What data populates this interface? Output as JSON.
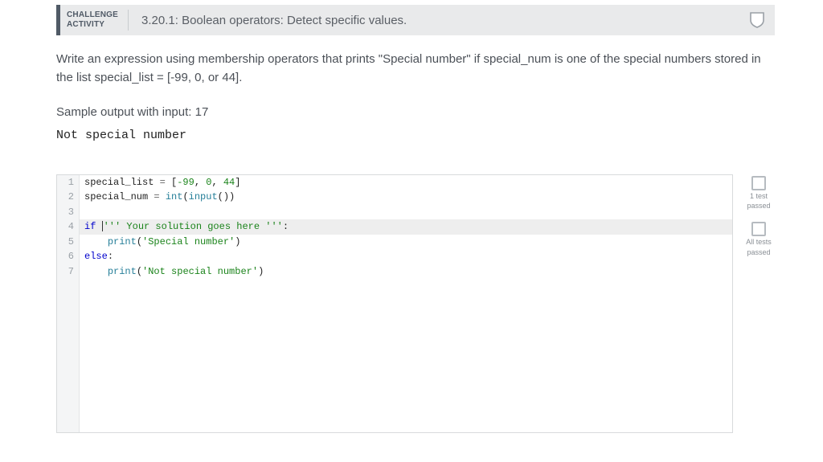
{
  "header": {
    "label_line1": "CHALLENGE",
    "label_line2": "ACTIVITY",
    "title": "3.20.1: Boolean operators: Detect specific values."
  },
  "instructions": "Write an expression using membership operators that prints \"Special number\" if special_num is one of the special numbers stored in the list special_list = [-99, 0, or 44].",
  "sample": {
    "label": "Sample output with input: 17",
    "output": "Not special number"
  },
  "code": {
    "line1": {
      "num": "1",
      "a": "special_list ",
      "op": "=",
      "b": " [",
      "n1": "-99",
      "c1": ", ",
      "n2": "0",
      "c2": ", ",
      "n3": "44",
      "c3": "]"
    },
    "line2": {
      "num": "2",
      "a": "special_num ",
      "op": "=",
      "b": " ",
      "fn1": "int",
      "p1": "(",
      "fn2": "input",
      "p2": "())"
    },
    "line3": {
      "num": "3"
    },
    "line4": {
      "num": "4",
      "kw": "if ",
      "s1": "''' Your solution goes here '''",
      "colon": ":"
    },
    "line5": {
      "num": "5",
      "indent": "    ",
      "fn": "print",
      "p1": "(",
      "str": "'Special number'",
      "p2": ")"
    },
    "line6": {
      "num": "6",
      "kw": "else",
      "colon": ":"
    },
    "line7": {
      "num": "7",
      "indent": "    ",
      "fn": "print",
      "p1": "(",
      "str": "'Not special number'",
      "p2": ")"
    }
  },
  "tests": {
    "t1_line1": "1 test",
    "t1_line2": "passed",
    "t2_line1": "All tests",
    "t2_line2": "passed"
  }
}
